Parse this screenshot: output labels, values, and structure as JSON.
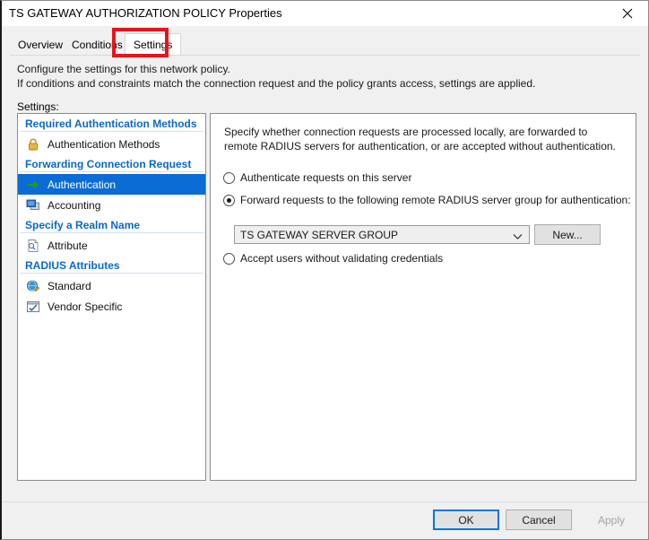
{
  "window": {
    "title": "TS GATEWAY AUTHORIZATION POLICY Properties",
    "close_label": "✕",
    "close_icon": "close-icon"
  },
  "tabs": [
    {
      "label": "Overview",
      "selected": false
    },
    {
      "label": "Conditions",
      "selected": false
    },
    {
      "label": "Settings",
      "selected": true
    }
  ],
  "annotation": {
    "color": "#e8141b",
    "target_tab": "Settings"
  },
  "description": {
    "line1": "Configure the settings for this network policy.",
    "line2": "If conditions and constraints match the connection request and the policy grants access, settings are applied.",
    "settings_label": "Settings:"
  },
  "settings_list": {
    "groups": [
      {
        "header": "Required Authentication Methods",
        "items": [
          {
            "label": "Authentication Methods",
            "icon": "padlock-icon",
            "selected": false
          }
        ]
      },
      {
        "header": "Forwarding Connection Request",
        "items": [
          {
            "label": "Authentication",
            "icon": "green-arrow-icon",
            "selected": true
          },
          {
            "label": "Accounting",
            "icon": "monitor-icon",
            "selected": false
          }
        ]
      },
      {
        "header": "Specify a Realm Name",
        "items": [
          {
            "label": "Attribute",
            "icon": "document-search-icon",
            "selected": false
          }
        ]
      },
      {
        "header": "RADIUS Attributes",
        "items": [
          {
            "label": "Standard",
            "icon": "globe-pencil-icon",
            "selected": false
          },
          {
            "label": "Vendor Specific",
            "icon": "window-check-icon",
            "selected": false
          }
        ]
      }
    ],
    "header_color": "#0a68c8",
    "selection_color": "#0a6cd4"
  },
  "content": {
    "intro": "Specify whether connection requests are processed locally, are forwarded to remote RADIUS servers for authentication, or are accepted without authentication.",
    "options": [
      {
        "label": "Authenticate requests on this server",
        "checked": false
      },
      {
        "label": "Forward requests to the following remote RADIUS server group for authentication:",
        "checked": true
      },
      {
        "label": "Accept users without validating credentials",
        "checked": false
      }
    ],
    "server_group": {
      "value": "TS GATEWAY SERVER GROUP",
      "chevron_icon": "chevron-down-icon",
      "new_button": "New..."
    }
  },
  "footer": {
    "ok": "OK",
    "cancel": "Cancel",
    "apply": "Apply",
    "apply_disabled": true,
    "focus_color": "#0078d7"
  }
}
